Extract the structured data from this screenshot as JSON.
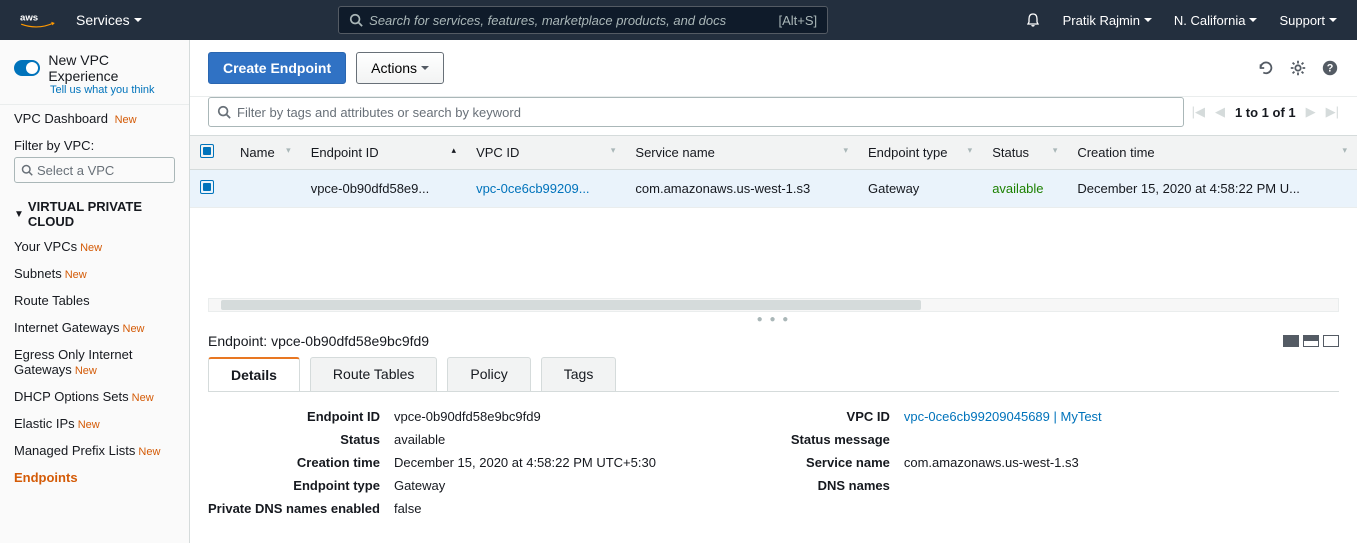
{
  "topnav": {
    "services": "Services",
    "search_placeholder": "Search for services, features, marketplace products, and docs",
    "shortcut": "[Alt+S]",
    "user": "Pratik Rajmin",
    "region": "N. California",
    "support": "Support"
  },
  "sidebar": {
    "new_experience": "New VPC Experience",
    "tell_us": "Tell us what you think",
    "dashboard": "VPC Dashboard",
    "dashboard_new": "New",
    "filter_label": "Filter by VPC:",
    "filter_placeholder": "Select a VPC",
    "heading": "VIRTUAL PRIVATE CLOUD",
    "items": [
      {
        "label": "Your VPCs",
        "new": true
      },
      {
        "label": "Subnets",
        "new": true
      },
      {
        "label": "Route Tables",
        "new": false
      },
      {
        "label": "Internet Gateways",
        "new": true
      },
      {
        "label": "Egress Only Internet Gateways",
        "new": true
      },
      {
        "label": "DHCP Options Sets",
        "new": true
      },
      {
        "label": "Elastic IPs",
        "new": true
      },
      {
        "label": "Managed Prefix Lists",
        "new": true
      },
      {
        "label": "Endpoints",
        "new": false,
        "active": true
      }
    ]
  },
  "toolbar": {
    "create": "Create Endpoint",
    "actions": "Actions"
  },
  "filter": {
    "placeholder": "Filter by tags and attributes or search by keyword"
  },
  "pagination": {
    "text": "1 to 1 of 1"
  },
  "table": {
    "headers": [
      "Name",
      "Endpoint ID",
      "VPC ID",
      "Service name",
      "Endpoint type",
      "Status",
      "Creation time"
    ],
    "row": {
      "name": "",
      "endpoint_id": "vpce-0b90dfd58e9...",
      "vpc_id": "vpc-0ce6cb99209...",
      "service_name": "com.amazonaws.us-west-1.s3",
      "endpoint_type": "Gateway",
      "status": "available",
      "creation_time": "December 15, 2020 at 4:58:22 PM U..."
    }
  },
  "detail": {
    "title_label": "Endpoint:",
    "title_value": "vpce-0b90dfd58e9bc9fd9",
    "tabs": [
      "Details",
      "Route Tables",
      "Policy",
      "Tags"
    ],
    "left": {
      "endpoint_id_k": "Endpoint ID",
      "endpoint_id_v": "vpce-0b90dfd58e9bc9fd9",
      "status_k": "Status",
      "status_v": "available",
      "creation_k": "Creation time",
      "creation_v": "December 15, 2020 at 4:58:22 PM UTC+5:30",
      "type_k": "Endpoint type",
      "type_v": "Gateway",
      "pdns_k": "Private DNS names enabled",
      "pdns_v": "false"
    },
    "right": {
      "vpc_k": "VPC ID",
      "vpc_v": "vpc-0ce6cb99209045689 | MyTest",
      "msg_k": "Status message",
      "msg_v": "",
      "svc_k": "Service name",
      "svc_v": "com.amazonaws.us-west-1.s3",
      "dns_k": "DNS names",
      "dns_v": ""
    }
  }
}
